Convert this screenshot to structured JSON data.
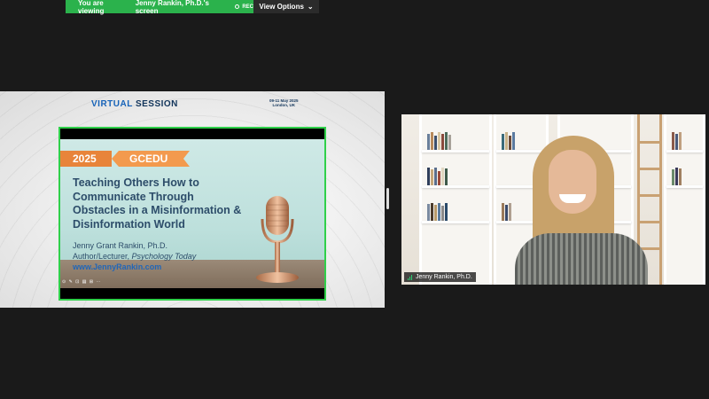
{
  "banner": {
    "viewing_prefix": "You are viewing",
    "viewing_name": "Jenny Rankin, Ph.D.'s screen",
    "rec_label": "REC",
    "view_options_label": "View Options",
    "view_options_icon": "chevron-down-icon"
  },
  "shared_screen": {
    "header_virtual": "VIRTUAL",
    "header_session": "SESSION",
    "date_line": "09-11 May 2025",
    "location_line": "London, UK",
    "slide": {
      "year": "2025",
      "conference": "GCEDU",
      "title": "Teaching Others How to Communicate Through Obstacles in a Misinformation & Disinformation World",
      "author": "Jenny Grant Rankin, Ph.D.",
      "role_prefix": "Author/Lecturer, ",
      "role_publication": "Psychology Today",
      "website": "www.JennyRankin.com",
      "toolbar_glyphs": "⊙ ✎ ⊡ ▤ ⊞ ⋯"
    }
  },
  "video_tile": {
    "participant_name": "Jenny Rankin, Ph.D."
  },
  "colors": {
    "active_speaker_border": "#2fd04a",
    "banner_green": "#2bb24c",
    "tag_orange": "#e8843a"
  }
}
